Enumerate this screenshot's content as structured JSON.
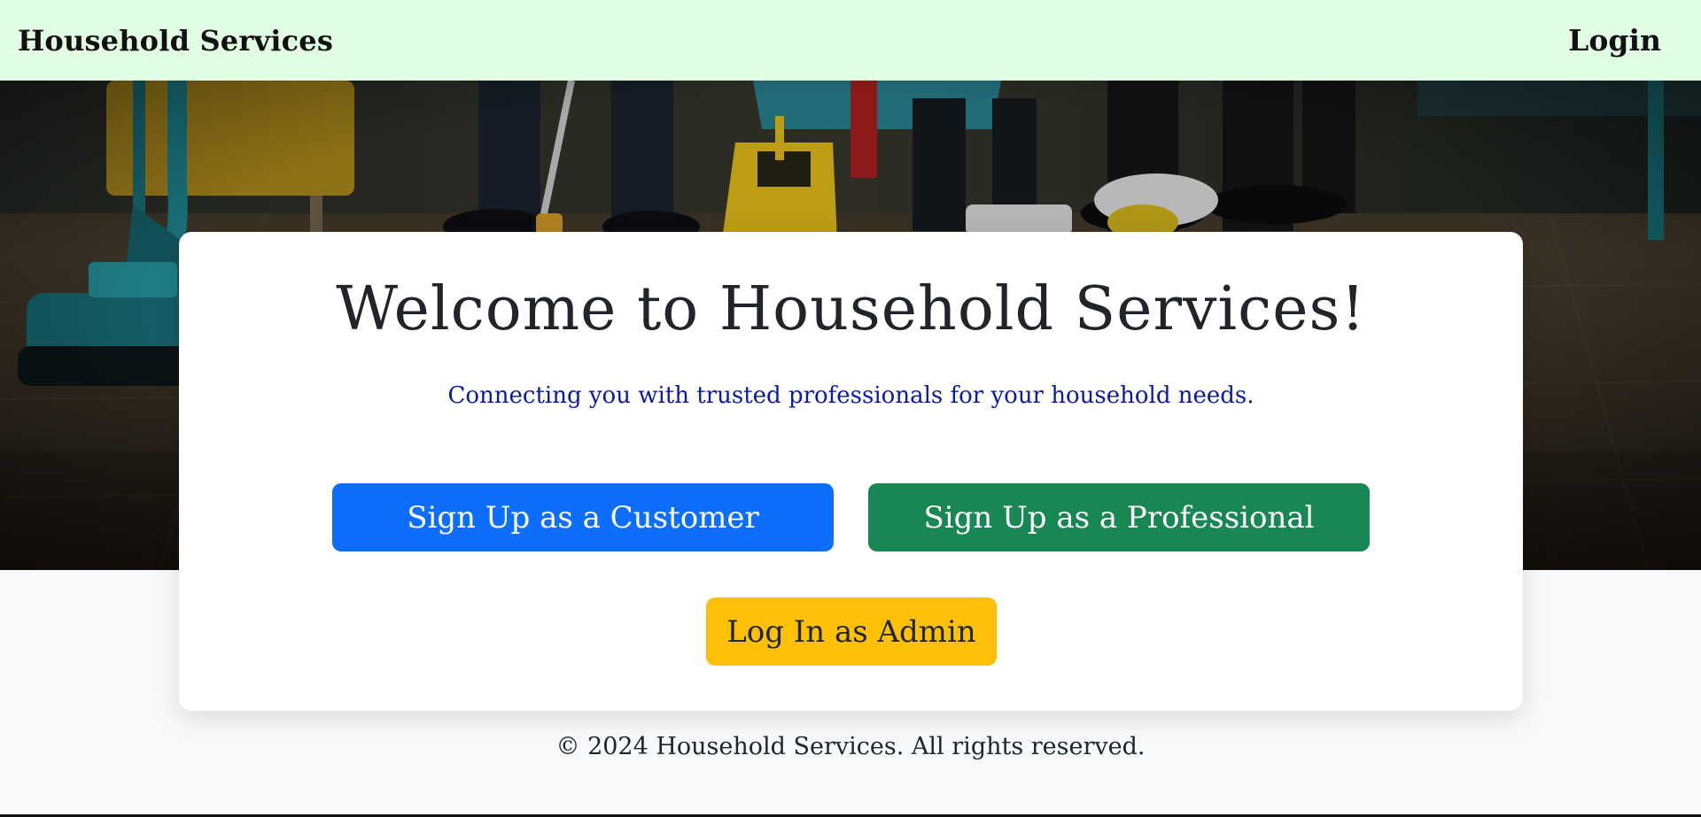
{
  "navbar": {
    "brand": "Household Services",
    "login_label": "Login",
    "background_color": "#e1fde2"
  },
  "hero": {
    "image_subject": "cleaning-staff-with-mops-and-supplies"
  },
  "welcome": {
    "title": "Welcome to Household Services!",
    "tagline": "Connecting you with trusted professionals for your household needs."
  },
  "buttons": {
    "customer_label": "Sign Up as a Customer",
    "professional_label": "Sign Up as a Professional",
    "admin_label": "Log In as Admin"
  },
  "colors": {
    "customer_button": "#0d6efd",
    "professional_button": "#198754",
    "admin_button": "#ffc107",
    "tagline": "#0a1aa6"
  },
  "footer": {
    "copyright": "© 2024 Household Services. All rights reserved."
  }
}
